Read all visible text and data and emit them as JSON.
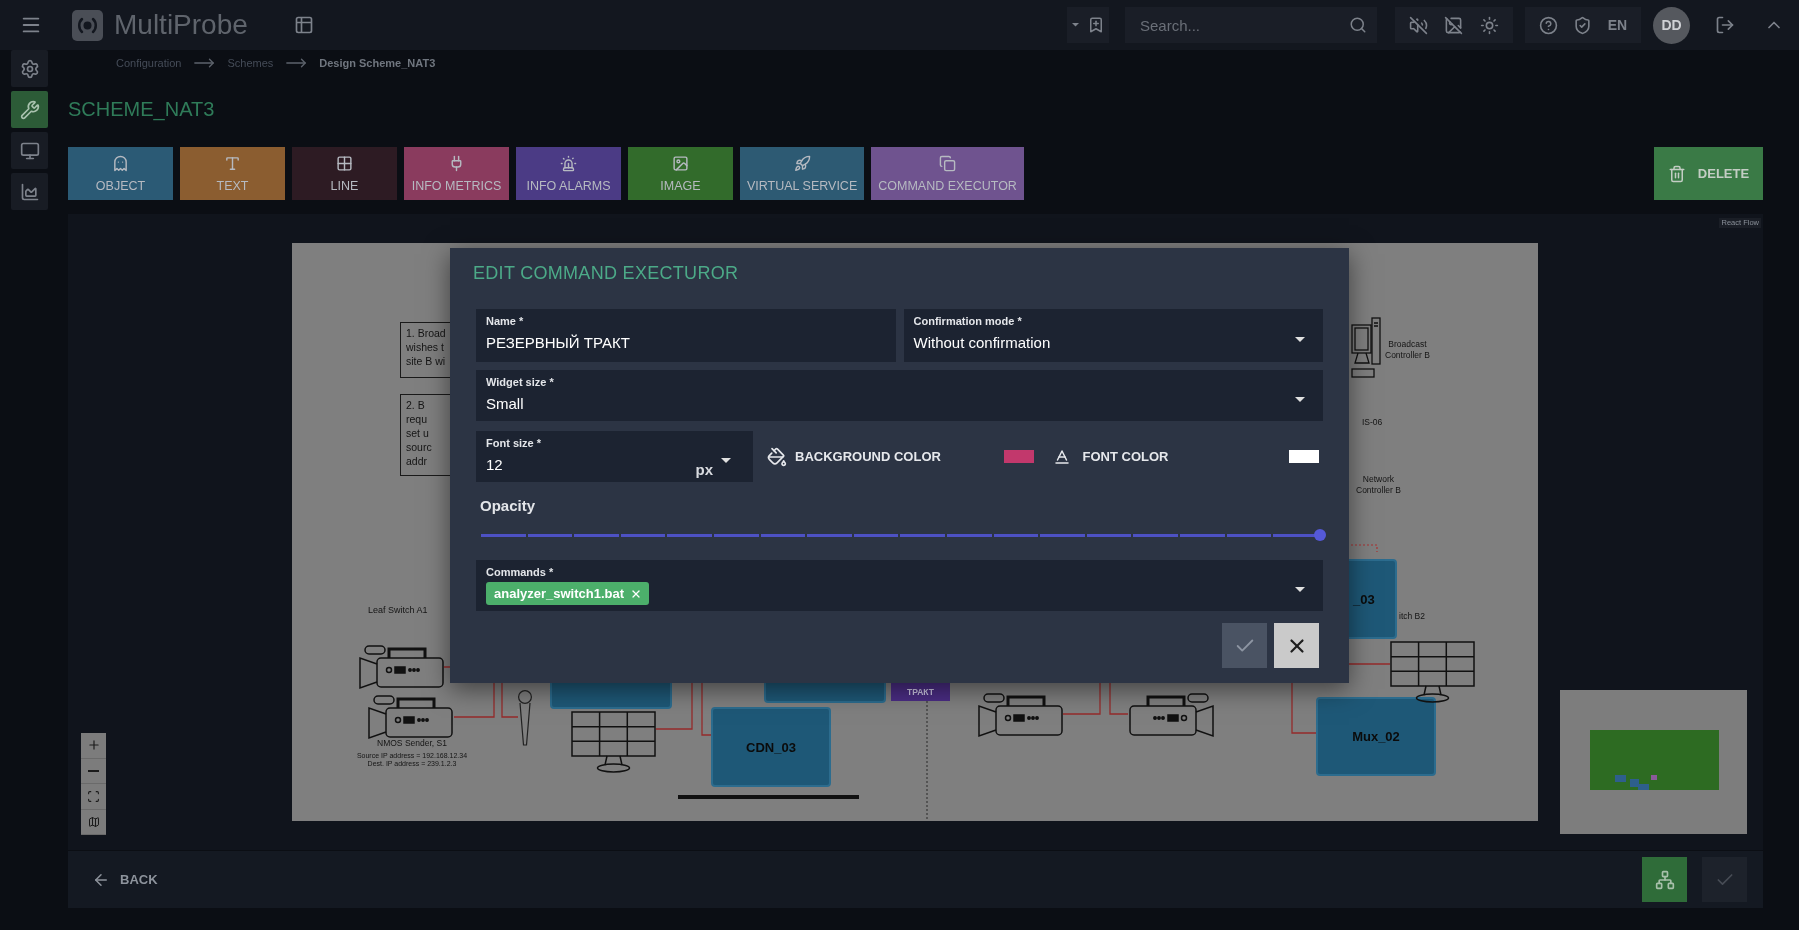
{
  "top_bar": {
    "logo": "MultiProbe",
    "search": {
      "placeholder": "Search..."
    },
    "language": "EN",
    "avatar": "DD"
  },
  "sidebar": {
    "items": [
      {
        "selected": false
      },
      {
        "selected": true
      },
      {
        "selected": false
      },
      {
        "selected": false
      }
    ]
  },
  "breadcrumbs": [
    "Configuration",
    "Schemes",
    "Design Scheme_NAT3"
  ],
  "page_title": "SCHEME_NAT3",
  "toolbar": {
    "tools": [
      {
        "label": "OBJECT",
        "color": "#2b5a75"
      },
      {
        "label": "TEXT",
        "color": "#8b5d30"
      },
      {
        "label": "LINE",
        "color": "#2d1b23"
      },
      {
        "label": "INFO METRICS",
        "color": "#8a3b5e"
      },
      {
        "label": "INFO ALARMS",
        "color": "#4b3b85"
      },
      {
        "label": "IMAGE",
        "color": "#326b2b"
      },
      {
        "label": "VIRTUAL SERVICE",
        "color": "#2d5a73"
      },
      {
        "label": "COMMAND EXECUTOR",
        "color": "#6f538f"
      }
    ],
    "delete": "DELETE"
  },
  "canvas": {
    "attribution": "React Flow",
    "notes": [
      {
        "lines": [
          "1. Broad",
          "wishes t",
          "site B wi"
        ]
      },
      {
        "lines": [
          "2. B",
          "requ",
          "set u",
          "sourc",
          "addr"
        ]
      }
    ],
    "captions": [
      {
        "lines": [
          "Leaf Switch A1"
        ]
      },
      {
        "lines": [
          "Broadcast",
          "Controller B"
        ]
      },
      {
        "lines": [
          "IS-06"
        ]
      },
      {
        "lines": [
          "Network",
          "Controller B"
        ]
      },
      {
        "lines": [
          "itch B2"
        ]
      }
    ],
    "sender": {
      "name": "NMOS Sender, S1",
      "details": [
        "Source IP address = 192.168.12.34",
        "Dest. IP address = 239.1.2.3"
      ]
    },
    "nodes": [
      {
        "label": "CDN_03"
      },
      {
        "label": "Mux_02"
      },
      {
        "label": "_03"
      }
    ],
    "widget": {
      "label": "ТРАКТ"
    }
  },
  "bottom_bar": {
    "back": "BACK",
    "actions": [
      {
        "kind": "layout",
        "disabled": false
      },
      {
        "kind": "save",
        "disabled": true
      }
    ]
  },
  "dialog": {
    "title": "EDIT COMMAND EXECTUROR",
    "fields": [
      {
        "kind": "text",
        "label": "Name *",
        "value": "РЕЗЕРВНЫЙ ТРАКТ"
      },
      {
        "kind": "select",
        "label": "Confirmation mode *",
        "value": "Without confirmation"
      },
      {
        "kind": "select",
        "label": "Widget size *",
        "value": "Small"
      }
    ],
    "font_size": {
      "label": "Font size *",
      "value": "12",
      "unit": "px"
    },
    "colors": [
      {
        "label": "BACKGROUND COLOR",
        "color": "#c2386c"
      },
      {
        "label": "FONT COLOR",
        "color": "#ffffff"
      }
    ],
    "opacity": {
      "label": "Opacity",
      "level": 1
    },
    "commands": {
      "label": "Commands *",
      "chips": [
        "analyzer_switch1.bat"
      ]
    },
    "buttons": [
      {
        "kind": "confirm",
        "disabled": true
      },
      {
        "kind": "cancel",
        "disabled": false
      }
    ]
  }
}
